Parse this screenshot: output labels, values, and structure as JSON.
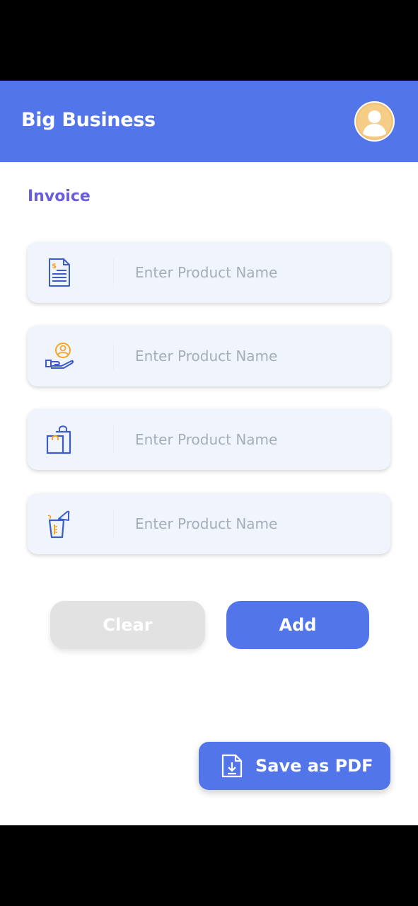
{
  "app_bar": {
    "title": "Big Business",
    "avatar_icon": "user-avatar-icon",
    "background": "#5375ea"
  },
  "main": {
    "section_title": "Invoice",
    "fields": [
      {
        "icon": "invoice-document-icon",
        "placeholder": "Enter Product Name",
        "value": ""
      },
      {
        "icon": "customer-hand-icon",
        "placeholder": "Enter Product Name",
        "value": ""
      },
      {
        "icon": "shopping-bags-icon",
        "placeholder": "Enter Product Name",
        "value": ""
      },
      {
        "icon": "product-cup-icon",
        "placeholder": "Enter Product Name",
        "value": ""
      }
    ]
  },
  "actions": {
    "clear_label": "Clear",
    "add_label": "Add",
    "save_pdf_label": "Save as PDF",
    "save_pdf_icon": "download-file-icon"
  },
  "colors": {
    "accent": "#5375ea",
    "section_title": "#6b5de0",
    "icon_orange": "#f5a623",
    "field_background": "#f0f5fd",
    "clear_disabled": "#e2e2e2"
  }
}
